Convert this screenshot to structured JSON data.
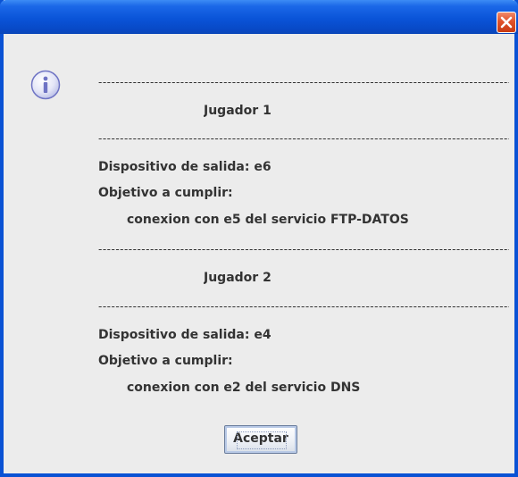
{
  "dialog": {
    "close_icon": "close-icon",
    "message_icon": "info-icon"
  },
  "message": {
    "separator": "-----------------------------------------------------------------------------------------------------------",
    "player1": {
      "title": "Jugador 1",
      "output_device": "Dispositivo de salida: e6",
      "objective_label": "Objetivo a cumplir:",
      "objective": "conexion con e5 del servicio FTP-DATOS"
    },
    "player2": {
      "title": "Jugador 2",
      "output_device": "Dispositivo de salida: e4",
      "objective_label": "Objetivo a cumplir:",
      "objective": "conexion con e2 del servicio DNS"
    }
  },
  "buttons": {
    "accept_label": "Aceptar"
  }
}
